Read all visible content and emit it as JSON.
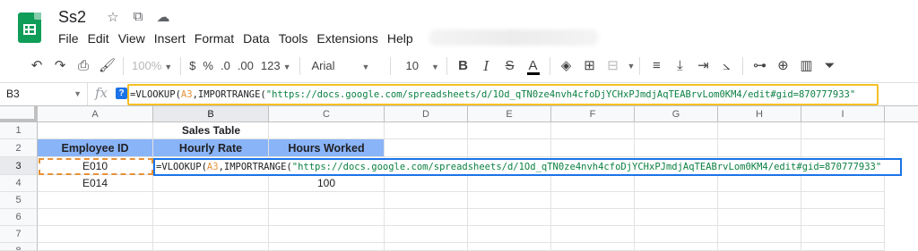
{
  "app": {
    "doc_title": "Ss2",
    "menu": [
      "File",
      "Edit",
      "View",
      "Insert",
      "Format",
      "Data",
      "Tools",
      "Extensions",
      "Help"
    ]
  },
  "toolbar": {
    "zoom": "100%",
    "currency": "$",
    "percent": "%",
    "dec_decrease": ".0",
    "dec_increase": ".00",
    "more_formats": "123",
    "font": "Arial",
    "font_size": "10",
    "bold": "B",
    "italic": "I",
    "strike": "S",
    "text_color": "A"
  },
  "formula_bar": {
    "cell_ref": "B3",
    "fx": "fx",
    "help": "?",
    "formula_eq": "=VLOOKUP(",
    "formula_ref": "A3",
    "formula_fn": ",IMPORTRANGE(",
    "formula_str": "\"https://docs.google.com/spreadsheets/d/1Od_qTN0ze4nvh4cfoDjYCHxPJmdjAqTEABrvLom0KM4/edit#gid=870777933\""
  },
  "grid": {
    "columns": [
      "A",
      "B",
      "C",
      "D",
      "E",
      "F",
      "G",
      "H",
      "I"
    ],
    "rows": [
      "1",
      "2",
      "3",
      "4",
      "5",
      "6",
      "7",
      "8"
    ],
    "cells": {
      "B1": "Sales Table",
      "A2": "Employee ID",
      "B2": "Hourly Rate",
      "C2": "Hours Worked",
      "A3": "E010",
      "A4": "E014",
      "C4": "100"
    }
  },
  "colors": {
    "header_fill": "#8ab4f8",
    "reference_highlight": "#e69138",
    "formula_bar_highlight": "#f6bf26",
    "active_cell": "#1a73e8",
    "string_literal": "#0b8043"
  }
}
